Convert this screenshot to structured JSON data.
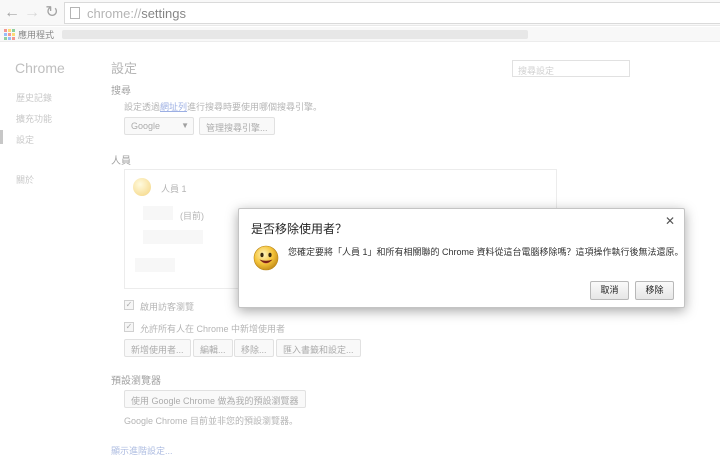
{
  "browser": {
    "url_scheme": "chrome://",
    "url_path": "settings",
    "apps_label": "應用程式"
  },
  "sidebar": {
    "title": "Chrome",
    "items": [
      "歷史記錄",
      "擴充功能",
      "設定",
      "關於"
    ]
  },
  "settings": {
    "heading": "設定",
    "search_placeholder": "搜尋設定",
    "search": {
      "heading": "搜尋",
      "desc_prefix": "設定透過",
      "desc_link": "網址列",
      "desc_suffix": "進行搜尋時要使用哪個搜尋引擎。",
      "engine": "Google",
      "manage_button": "管理搜尋引擎..."
    },
    "people": {
      "heading": "人員",
      "person_name": "人員 1",
      "current_label": "(目前)",
      "guest_browsing": "啟用訪客瀏覽",
      "let_anyone_add": "允許所有人在 Chrome 中新增使用者",
      "add_person": "新增使用者...",
      "edit": "編輯...",
      "remove": "移除...",
      "import": "匯入書籤和設定..."
    },
    "default_browser": {
      "heading": "預設瀏覽器",
      "make_default": "使用 Google Chrome 做為我的預設瀏覽器",
      "status": "Google Chrome 目前並非您的預設瀏覽器。"
    },
    "show_advanced": "顯示進階設定..."
  },
  "dialog": {
    "title": "是否移除使用者？",
    "message": "您確定要將「人員 1」和所有相關聯的 Chrome 資料從這台電腦移除嗎？這項操作執行後無法還原。",
    "cancel": "取消",
    "remove": "移除",
    "close_icon": "close-icon"
  }
}
